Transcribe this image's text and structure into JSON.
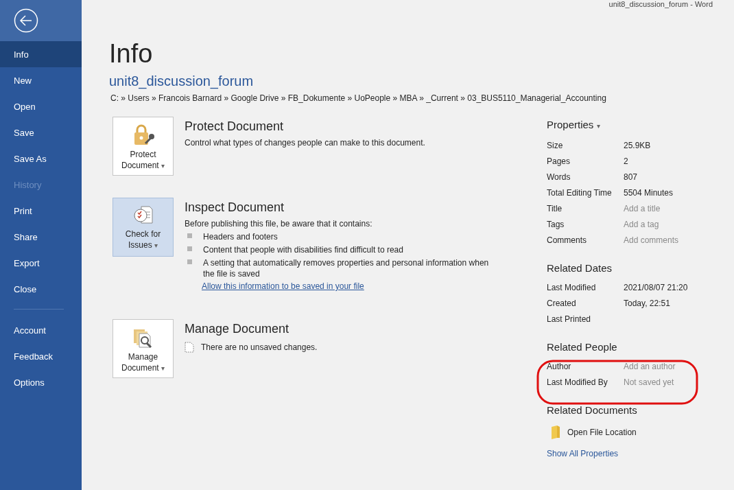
{
  "window": {
    "title": "unit8_discussion_forum  -  Word"
  },
  "sidebar": {
    "items": [
      {
        "label": "Info",
        "selected": true,
        "disabled": false
      },
      {
        "label": "New",
        "selected": false,
        "disabled": false
      },
      {
        "label": "Open",
        "selected": false,
        "disabled": false
      },
      {
        "label": "Save",
        "selected": false,
        "disabled": false
      },
      {
        "label": "Save As",
        "selected": false,
        "disabled": false
      },
      {
        "label": "History",
        "selected": false,
        "disabled": true
      },
      {
        "label": "Print",
        "selected": false,
        "disabled": false
      },
      {
        "label": "Share",
        "selected": false,
        "disabled": false
      },
      {
        "label": "Export",
        "selected": false,
        "disabled": false
      },
      {
        "label": "Close",
        "selected": false,
        "disabled": false
      }
    ],
    "footer_items": [
      {
        "label": "Account",
        "selected": false,
        "disabled": false
      },
      {
        "label": "Feedback",
        "selected": false,
        "disabled": false
      },
      {
        "label": "Options",
        "selected": false,
        "disabled": false
      }
    ]
  },
  "page": {
    "heading": "Info",
    "document_name": "unit8_discussion_forum",
    "path": "C: » Users » Francois Barnard » Google Drive » FB_Dokumente » UoPeople » MBA » _Current » 03_BUS5110_Managerial_Accounting"
  },
  "sections": [
    {
      "kind": "protect",
      "button": [
        "Protect",
        "Document"
      ],
      "caret": "▾",
      "highlighted": false,
      "title": "Protect Document",
      "description": "Control what types of changes people can make to this document."
    },
    {
      "kind": "inspect",
      "button": [
        "Check for",
        "Issues"
      ],
      "caret": "▾",
      "highlighted": true,
      "title": "Inspect Document",
      "description": "Before publishing this file, be aware that it contains:",
      "bullets": [
        "Headers and footers",
        "Content that people with disabilities find difficult to read",
        "A setting that automatically removes properties and personal information when the file is saved"
      ],
      "link": "Allow this information to be saved in your file"
    },
    {
      "kind": "manage",
      "button": [
        "Manage",
        "Document"
      ],
      "caret": "▾",
      "highlighted": false,
      "title": "Manage Document",
      "note": "There are no unsaved changes."
    }
  ],
  "properties": {
    "title": "Properties",
    "caret": "▾",
    "rows": [
      {
        "label": "Size",
        "value": "25.9KB"
      },
      {
        "label": "Pages",
        "value": "2"
      },
      {
        "label": "Words",
        "value": "807"
      },
      {
        "label": "Total Editing Time",
        "value": "5504 Minutes"
      },
      {
        "label": "Title",
        "placeholder": "Add a title"
      },
      {
        "label": "Tags",
        "placeholder": "Add a tag"
      },
      {
        "label": "Comments",
        "placeholder": "Add comments"
      }
    ]
  },
  "related_dates": {
    "title": "Related Dates",
    "rows": [
      {
        "label": "Last Modified",
        "value": "2021/08/07 21:20"
      },
      {
        "label": "Created",
        "value": "Today, 22:51"
      },
      {
        "label": "Last Printed"
      }
    ]
  },
  "related_people": {
    "title": "Related People",
    "rows": [
      {
        "label": "Author",
        "placeholder": "Add an author"
      },
      {
        "label": "Last Modified By",
        "placeholder": "Not saved yet"
      }
    ]
  },
  "related_documents": {
    "title": "Related Documents",
    "open_location": "Open File Location",
    "show_all": "Show All Properties"
  }
}
